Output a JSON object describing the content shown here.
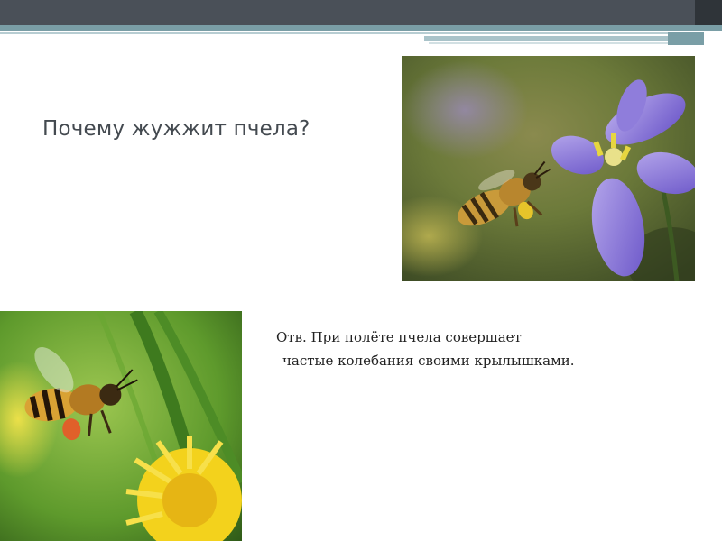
{
  "slide": {
    "title": "Почему жужжит пчела?",
    "answer_line1": "Отв. При полёте пчела совершает",
    "answer_line2": "частые колебания своими крылышками."
  },
  "images": {
    "top_photo": {
      "subject": "bee-approaching-purple-flower-icon"
    },
    "bottom_photo": {
      "subject": "bee-over-dandelion-icon"
    }
  },
  "colors": {
    "header_bar": "#4a5058",
    "accent": "#7a9ea6",
    "title_text": "#444a50",
    "body_text": "#222222"
  }
}
